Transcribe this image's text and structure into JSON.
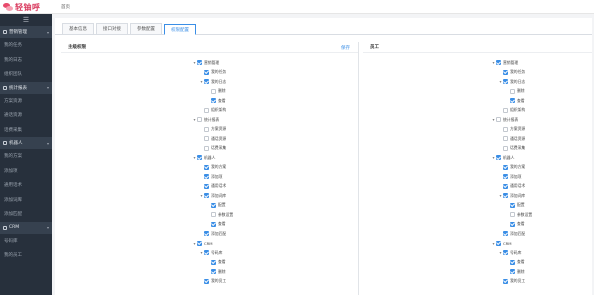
{
  "app": {
    "logo_text": "轻铀呼",
    "breadcrumb": "首页",
    "brand_color": "#d93a5e",
    "accent_color": "#3a8ee6"
  },
  "sidebar": {
    "toggle_icon": "menu-icon",
    "sections": [
      {
        "label": "营销管理",
        "items": [
          "我的任务",
          "我的日志",
          "组织团队"
        ]
      },
      {
        "label": "统计报表",
        "items": [
          "方案资源",
          "通话资源",
          "话费采集"
        ]
      },
      {
        "label": "机器人",
        "items": [
          "我的方案",
          "添加项",
          "通用话术",
          "添加词库",
          "添加匹配"
        ]
      },
      {
        "label": "CRM",
        "items": [
          "号码库",
          "我的员工"
        ]
      }
    ]
  },
  "tabs": [
    {
      "label": "基本信息",
      "active": false
    },
    {
      "label": "接口对接",
      "active": false
    },
    {
      "label": "参数配置",
      "active": false
    },
    {
      "label": "权限配置",
      "active": true
    }
  ],
  "left_panel": {
    "title": "主级权限",
    "action": "保存"
  },
  "right_panel": {
    "title": "员工"
  },
  "tree": [
    {
      "label": "营销管理",
      "level": 0,
      "arrow": true,
      "checked": true
    },
    {
      "label": "我的任务",
      "level": 1,
      "arrow": false,
      "checked": true
    },
    {
      "label": "我的日志",
      "level": 1,
      "arrow": true,
      "checked": true
    },
    {
      "label": "删除",
      "level": 2,
      "arrow": false,
      "checked": false
    },
    {
      "label": "查看",
      "level": 2,
      "arrow": false,
      "checked": true
    },
    {
      "label": "组织架构",
      "level": 1,
      "arrow": false,
      "checked": false
    },
    {
      "label": "统计报表",
      "level": 0,
      "arrow": true,
      "checked": false
    },
    {
      "label": "方案资源",
      "level": 1,
      "arrow": false,
      "checked": false
    },
    {
      "label": "通话资源",
      "level": 1,
      "arrow": false,
      "checked": false
    },
    {
      "label": "话费采集",
      "level": 1,
      "arrow": false,
      "checked": false
    },
    {
      "label": "机器人",
      "level": 0,
      "arrow": true,
      "checked": true
    },
    {
      "label": "我的方案",
      "level": 1,
      "arrow": false,
      "checked": true
    },
    {
      "label": "添加项",
      "level": 1,
      "arrow": false,
      "checked": true
    },
    {
      "label": "通用话术",
      "level": 1,
      "arrow": false,
      "checked": true
    },
    {
      "label": "添加词库",
      "level": 1,
      "arrow": true,
      "checked": true
    },
    {
      "label": "配置",
      "level": 2,
      "arrow": false,
      "checked": true
    },
    {
      "label": "参数设置",
      "level": 2,
      "arrow": false,
      "checked": false
    },
    {
      "label": "查看",
      "level": 2,
      "arrow": false,
      "checked": true
    },
    {
      "label": "添加匹配",
      "level": 1,
      "arrow": false,
      "checked": true
    },
    {
      "label": "CRM",
      "level": 0,
      "arrow": true,
      "checked": true
    },
    {
      "label": "号码库",
      "level": 1,
      "arrow": true,
      "checked": true
    },
    {
      "label": "查看",
      "level": 2,
      "arrow": false,
      "checked": true
    },
    {
      "label": "删除",
      "level": 2,
      "arrow": false,
      "checked": true
    },
    {
      "label": "我的员工",
      "level": 1,
      "arrow": false,
      "checked": true
    }
  ]
}
